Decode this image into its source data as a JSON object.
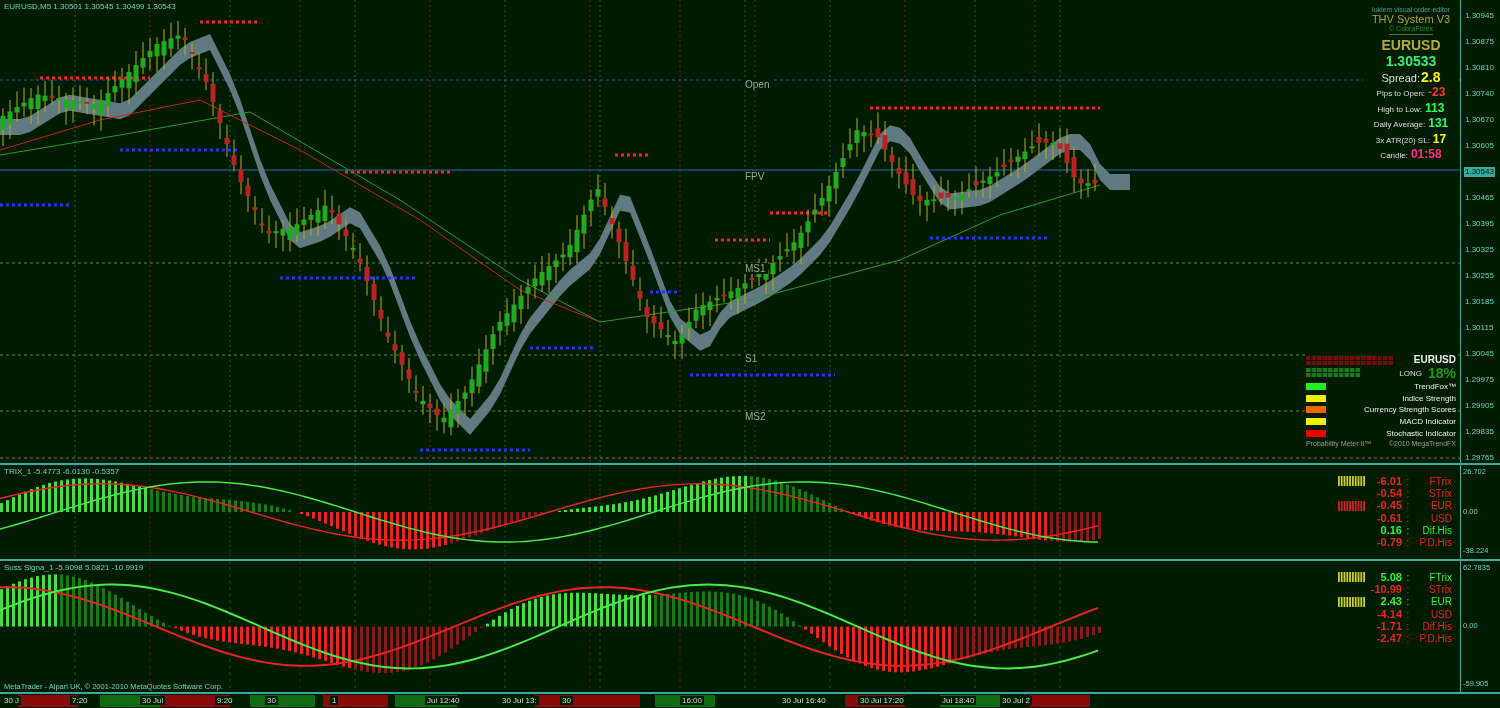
{
  "main_chart": {
    "header": "EURUSD,M5  1.30501 1.30545 1.30499 1.30543",
    "levels": [
      {
        "label": "Open"
      },
      {
        "label": "FPV"
      },
      {
        "label": "MS1"
      },
      {
        "label": "S1"
      },
      {
        "label": "MS2"
      }
    ],
    "price_axis": [
      {
        "label": "1.30945",
        "current": false
      },
      {
        "label": "1.30875",
        "current": false
      },
      {
        "label": "1.30810",
        "current": false
      },
      {
        "label": "1.30740",
        "current": false
      },
      {
        "label": "1.30670",
        "current": false
      },
      {
        "label": "1.30605",
        "current": false
      },
      {
        "label": "1.30543",
        "current": true
      },
      {
        "label": "1.30465",
        "current": false
      },
      {
        "label": "1.30395",
        "current": false
      },
      {
        "label": "1.30325",
        "current": false
      },
      {
        "label": "1.30255",
        "current": false
      },
      {
        "label": "1.30185",
        "current": false
      },
      {
        "label": "1.30115",
        "current": false
      },
      {
        "label": "1.30045",
        "current": false
      },
      {
        "label": "1.29975",
        "current": false
      },
      {
        "label": "1.29905",
        "current": false
      },
      {
        "label": "1.29835",
        "current": false
      },
      {
        "label": "1.29765",
        "current": false
      }
    ],
    "info_box": {
      "caption": "lukiem visual order editor",
      "title": "THV System V3",
      "credit": "© CobraForex",
      "symbol": "EURUSD",
      "price": "1.30533",
      "spread_label": "Spread:",
      "spread": "2.8",
      "rows": [
        {
          "label": "Pips to Open:",
          "value": "-23",
          "color": "#ff3b1f"
        },
        {
          "label": "High to Low:",
          "value": "113",
          "color": "#22ff66"
        },
        {
          "label": "Daily Average:",
          "value": "131",
          "color": "#22ff66"
        },
        {
          "label": "3x ATR(20) SL:",
          "value": "17",
          "color": "#ffff00"
        },
        {
          "label": "Candle:",
          "value": "01:58",
          "color": "#ff2a8a"
        }
      ]
    },
    "probability_meter": {
      "symbol": "EURUSD",
      "direction": "LONG",
      "percent": "18%",
      "indicators": [
        {
          "label": "TrendFox™",
          "color": "#22ee22"
        },
        {
          "label": "Indice Strength",
          "color": "#eeee00"
        },
        {
          "label": "Currency Strength Scores",
          "color": "#ee6600"
        },
        {
          "label": "MACD Indicator",
          "color": "#eeee00"
        },
        {
          "label": "Stochastic Indicator",
          "color": "#ee0000"
        }
      ],
      "footer_left": "Probability Meter II™",
      "footer_right": "©2010 MegaTrendFX"
    }
  },
  "indicator_panels": [
    {
      "header": "TRIX_1 -5.4773 -6.0130 -0.5357",
      "axis": [
        "26.702",
        "0.00",
        "-38.224"
      ],
      "rows": [
        {
          "value": "-6.01",
          "separator": ":",
          "name": "FTrix",
          "color": "#ee2222",
          "bar": {
            "color": "#cccc22"
          }
        },
        {
          "value": "-0.54",
          "separator": ":",
          "name": "STrix",
          "color": "#ee2222"
        },
        {
          "value": "-0.45",
          "separator": ":",
          "name": "EUR",
          "color": "#ee2222",
          "bar": {
            "color": "#cc2222"
          }
        },
        {
          "value": "-0.61",
          "separator": ":",
          "name": "USD",
          "color": "#ee2222"
        },
        {
          "value": "0.16",
          "separator": ":",
          "name": "Dif.His",
          "color": "#33ee33"
        },
        {
          "value": "-0.79",
          "separator": ":",
          "name": "P.D.His",
          "color": "#ee2222"
        }
      ]
    },
    {
      "header": "Suss Signa_1 -5.9098 5.0821 -10.9919",
      "axis": [
        "62.7835",
        "0.00",
        "-59.905"
      ],
      "rows": [
        {
          "value": "5.08",
          "separator": ":",
          "name": "FTrix",
          "color": "#33ee33",
          "bar": {
            "color": "#cccc22"
          }
        },
        {
          "value": "-10.99",
          "separator": ":",
          "name": "STrix",
          "color": "#ee2222"
        },
        {
          "value": "2.43",
          "separator": ":",
          "name": "EUR",
          "color": "#33ee33",
          "bar": {
            "color": "#cccc22"
          }
        },
        {
          "value": "-4.14",
          "separator": ":",
          "name": "USD",
          "color": "#ee2222"
        },
        {
          "value": "-1.71",
          "separator": ":",
          "name": "Dif.His",
          "color": "#ee2222"
        },
        {
          "value": "-2.47",
          "separator": ":",
          "name": "P.D.His",
          "color": "#ee2222"
        }
      ]
    }
  ],
  "copyright": "MetaTrader - Alpari UK, © 2001-2010 MetaQuotes Software Corp.",
  "time_axis": [
    "30 J",
    "7:20",
    "30 Jul",
    "9:20",
    "30",
    "1",
    "Jul 12:40",
    "30 Jul 13:",
    "30",
    "16:00",
    "30 Jul 16:40",
    "30 Jul 17:20",
    "Jul 18:40",
    "30 Jul 2"
  ]
}
